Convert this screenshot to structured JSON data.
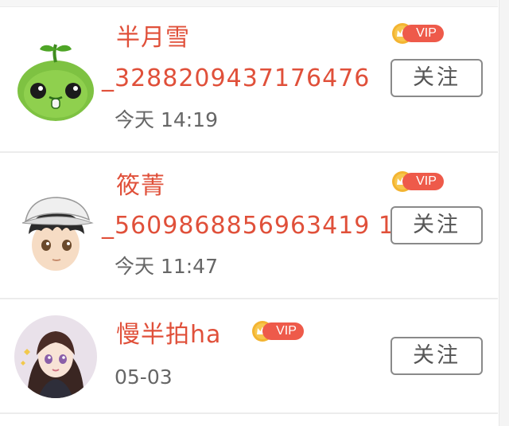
{
  "feed": {
    "items": [
      {
        "name_line1": "半月雪",
        "name_line2": "_3288209437176476",
        "badge": "VIP",
        "time": "今天 14:19",
        "follow_label": "关注",
        "avatar": "green-bean-sprout-avatar"
      },
      {
        "name_line1": "筱菁",
        "name_line2": "_5609868856963419 1",
        "badge": "VIP",
        "time": "今天 11:47",
        "follow_label": "关注",
        "avatar": "anime-boy-cap-avatar"
      },
      {
        "name_line1": "慢半拍ha",
        "badge": "VIP",
        "time": "05-03",
        "follow_label": "关注",
        "avatar": "anime-girl-avatar"
      }
    ]
  },
  "colors": {
    "name": "#e0503a",
    "vip_pill": "#ee5a4a",
    "vip_coin": "#f3b431",
    "time": "#666666",
    "button_border": "#8a8a8a"
  }
}
